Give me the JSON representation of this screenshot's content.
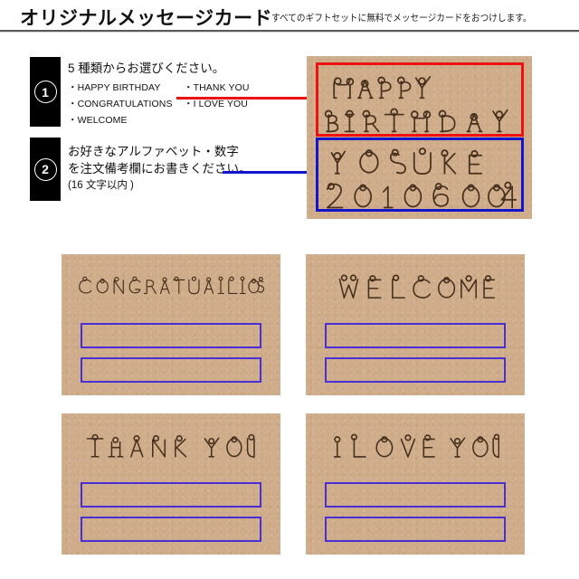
{
  "header": {
    "title": "オリジナルメッセージカード",
    "subtitle": "すべてのギフトセットに無料でメッセージカードをおつけします。"
  },
  "steps": [
    {
      "number": "1",
      "heading": "5 種類からお選びください。",
      "options": [
        "・HAPPY BIRTHDAY",
        "・THANK YOU",
        "・CONGRATULATIONS",
        "・I LOVE YOU",
        "・WELCOME"
      ]
    },
    {
      "number": "2",
      "lines": [
        "お好きなアルファベット・数字",
        "を注文備考欄にお書きください。"
      ],
      "note": "(16 文字以内 )"
    }
  ],
  "connectors": {
    "red_color": "#ee1111",
    "blue_color": "#1414cc"
  },
  "main_card": {
    "preset_line_1": "HAPPY",
    "preset_line_2": "BIRTHDAY",
    "custom_line_1": "YOSUKE",
    "custom_line_2": "20190604",
    "preset_outline_color": "#ee1111",
    "custom_outline_color": "#1414cc",
    "paper_color": "#cfac8a"
  },
  "sample_cards": [
    {
      "title": "CONGRATULATIONS",
      "slot_1": "",
      "slot_2": ""
    },
    {
      "title": "WELCOME",
      "slot_1": "",
      "slot_2": ""
    },
    {
      "title": "THANK YOU",
      "slot_1": "",
      "slot_2": ""
    },
    {
      "title": "I LOVE YOU",
      "slot_1": "",
      "slot_2": ""
    }
  ],
  "slot_border_color": "#4b2fd6"
}
